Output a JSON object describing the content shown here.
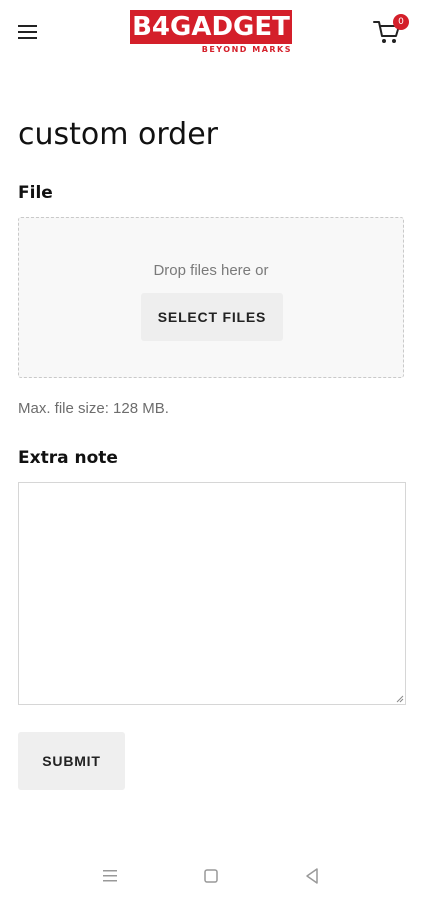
{
  "header": {
    "logo": {
      "brand": "B4GADGET",
      "tagline": "BEYOND MARKS"
    },
    "cart_count": "0",
    "icons": {
      "menu": "hamburger-menu-icon",
      "cart": "cart-icon"
    }
  },
  "page": {
    "title": "custom order",
    "file_label": "File",
    "drop_text": "Drop files here or",
    "select_button": "SELECT FILES",
    "max_size_hint": "Max. file size: 128 MB.",
    "note_label": "Extra note",
    "note_value": "",
    "submit_button": "SUBMIT"
  },
  "system_nav": {
    "icons": [
      "recent-apps-icon",
      "home-icon",
      "back-icon"
    ]
  },
  "colors": {
    "brand_red": "#d41f2a",
    "button_gray": "#eeeeee",
    "dropzone_bg": "#f8f8f8"
  }
}
